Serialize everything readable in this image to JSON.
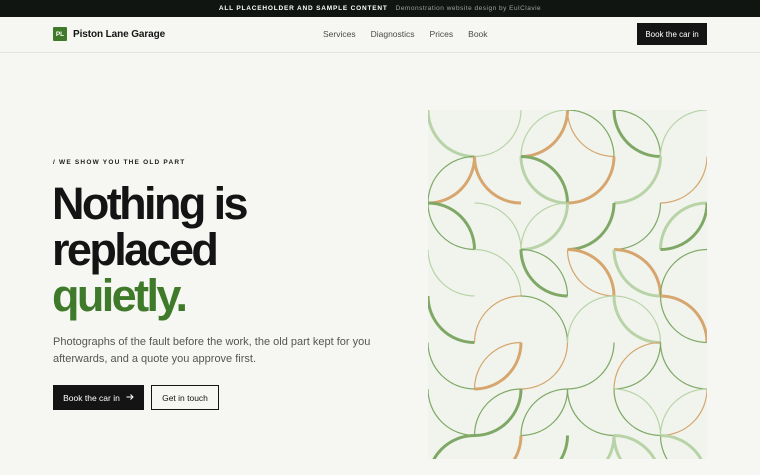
{
  "banner": {
    "strong": "ALL PLACEHOLDER AND SAMPLE CONTENT",
    "muted": "Demonstration website design by EulClavie"
  },
  "brand": {
    "logo": "PL",
    "name": "Piston Lane Garage"
  },
  "nav": {
    "items": [
      "Services",
      "Diagnostics",
      "Prices",
      "Book"
    ],
    "cta": "Book the car in"
  },
  "hero": {
    "eyebrow": "/ WE SHOW YOU THE OLD PART",
    "headline_line1": "Nothing is",
    "headline_line2": "replaced",
    "headline_accent": "quietly.",
    "lead": "Photographs of the fault before the work, the old part kept for you afterwards, and a quote you approve first.",
    "primary_cta": "Book the car in",
    "primary_cta_icon": "arrow-right-icon",
    "secondary_cta": "Get in touch"
  },
  "colors": {
    "accent_green": "#3f7a2a",
    "pattern_green": "#7fa866",
    "pattern_light_green": "#b9d3a8",
    "pattern_tan": "#d7a56e",
    "dark": "#141414",
    "page_bg": "#f6f6f3"
  }
}
